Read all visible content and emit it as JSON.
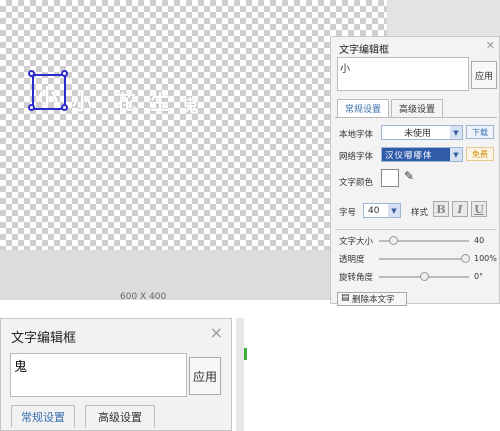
{
  "canvas": {
    "size_label": "600 X 400",
    "text_chars": [
      "小",
      "小",
      "花",
      "生",
      "鬼"
    ]
  },
  "panel": {
    "title": "文字编辑框",
    "close_icon": "close-icon",
    "input_value": "小",
    "apply_label": "应用",
    "tabs": [
      {
        "label": "常规设置",
        "active": true
      },
      {
        "label": "高级设置",
        "active": false
      }
    ],
    "local_font_label": "本地字体",
    "local_font_value": "未使用",
    "download_label": "下载",
    "web_font_label": "网络字体",
    "web_font_value": "汉仪嘟嘟体",
    "free_label": "免费",
    "color_label": "文字颜色",
    "size_label": "字号",
    "size_value": "40",
    "style_label": "样式",
    "style_buttons": [
      "B",
      "I",
      "U"
    ],
    "sliders": [
      {
        "label": "文字大小",
        "value": "40",
        "fraction": 0.15
      },
      {
        "label": "透明度",
        "value": "100%",
        "fraction": 0.95
      },
      {
        "label": "旋转角度",
        "value": "0°",
        "fraction": 0.5
      }
    ],
    "delete_label": "删除本文字"
  },
  "dialog": {
    "title": "文字编辑框",
    "close_symbol": "×",
    "input_value": "鬼",
    "apply_label": "应用",
    "tabs": [
      {
        "label": "常规设置",
        "active": true
      },
      {
        "label": "高级设置",
        "active": false
      }
    ]
  },
  "colors": {
    "accent": "#3a6fb0",
    "selection": "#2a2ad0"
  }
}
